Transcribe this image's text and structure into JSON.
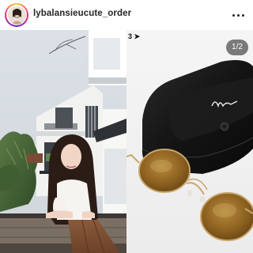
{
  "header": {
    "username": "lybalansieucute_order",
    "avatar_icon": "profile-avatar",
    "more_icon": "more-options-icon"
  },
  "post": {
    "status_time": "3",
    "status_icon": "location-arrow-icon",
    "carousel_counter": "1/2"
  },
  "colors": {
    "story_ring_start": "#f9ce34",
    "story_ring_mid": "#ee2a7b",
    "story_ring_end": "#6228d7",
    "badge_bg": "#2b2b2b"
  }
}
